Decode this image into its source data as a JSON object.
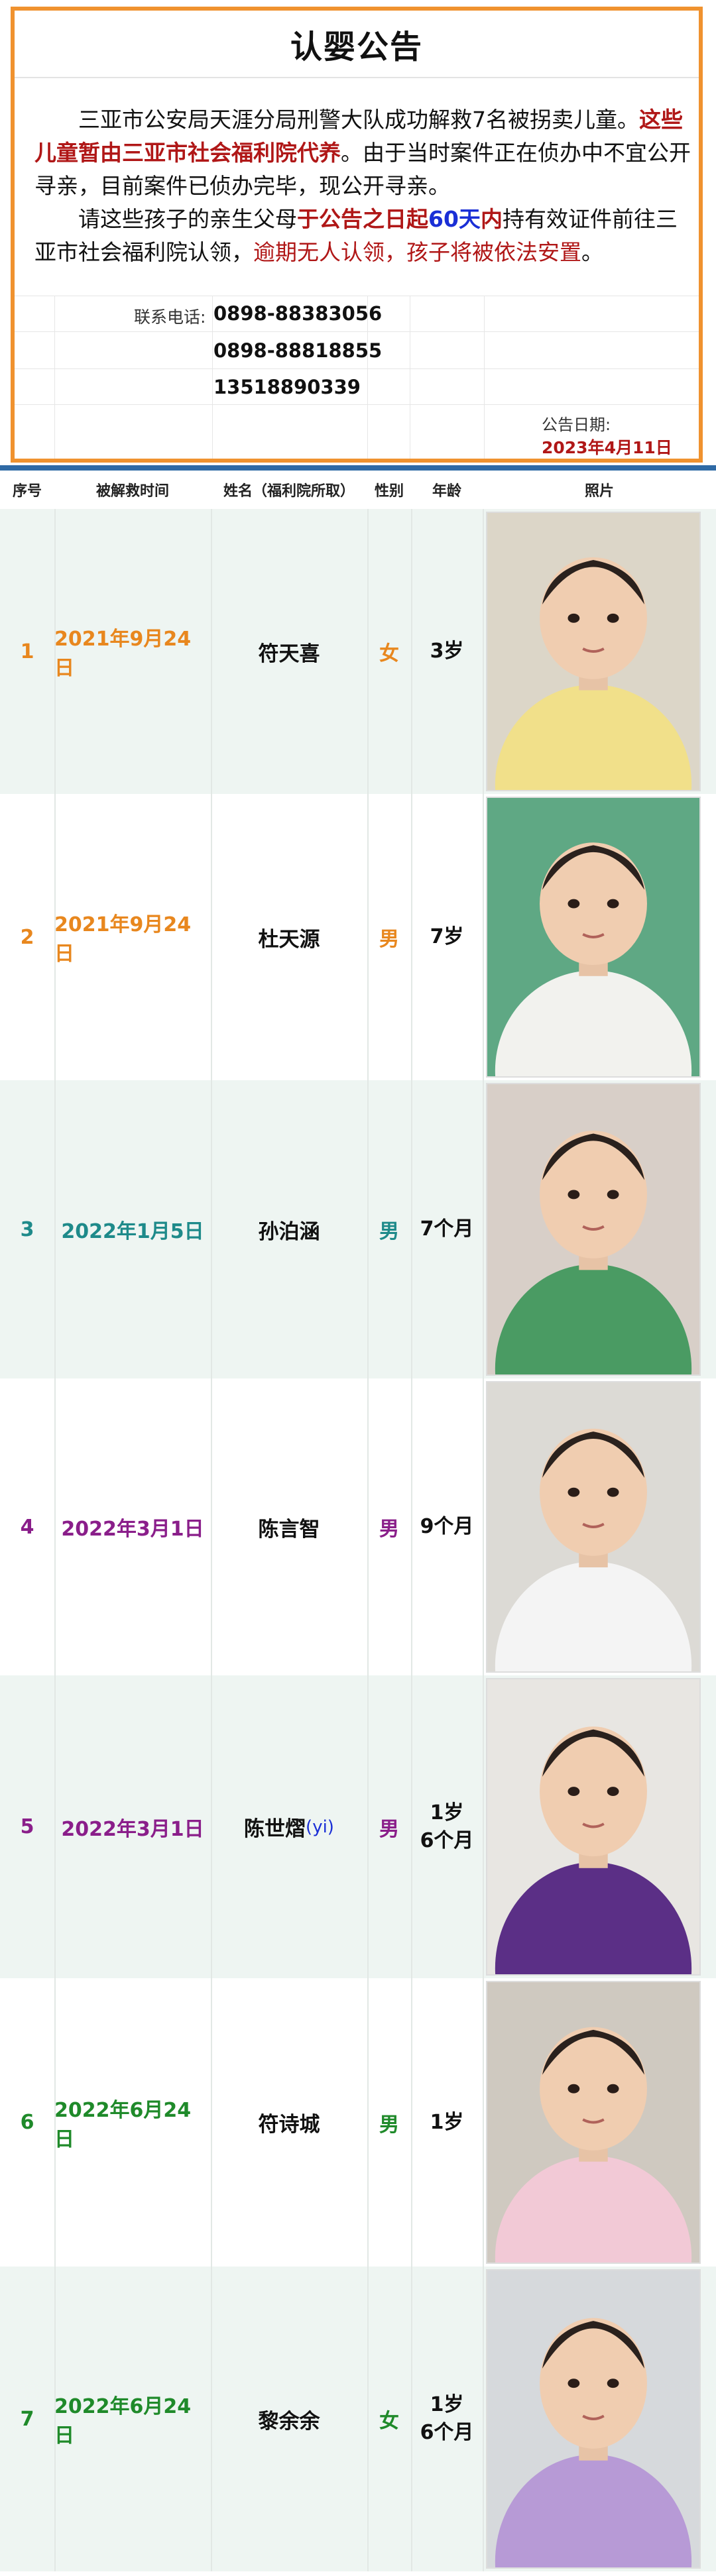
{
  "notice": {
    "title": "认婴公告",
    "para1_a": "三亚市公安局天涯分局刑警大队成功解救7名被拐卖儿童。",
    "para1_b": "这些儿童暂由三亚市社会福利院代养",
    "para1_c": "。由于当时案件正在侦办中不宜公开寻亲，目前案件已侦办完毕，现公开寻亲。",
    "para2_a": "请这些孩子的亲生父母",
    "para2_b": "于公告之日起",
    "para2_c": "60天",
    "para2_d": "内",
    "para2_e": "持有效证件前往三亚市社会福利院认领，",
    "para2_f": "逾期无人认领，孩子将被依法安置",
    "para2_g": "。",
    "contact_label": "联系电话:",
    "phones": [
      "0898-88383056",
      "0898-88818855",
      "13518890339"
    ],
    "date_label": "公告日期:",
    "date_value": "2023年4月11日"
  },
  "table": {
    "headers": [
      "序号",
      "被解救时间",
      "姓名（福利院所取）",
      "性别",
      "年龄",
      "照片"
    ],
    "rows": [
      {
        "no": "1",
        "date": "2021年9月24日",
        "name": "符天喜",
        "name_note": "",
        "gender": "女",
        "age1": "3岁",
        "age2": "",
        "color": "#e8871e",
        "shirt": "#f1e08a",
        "bg": "#dcd6c8"
      },
      {
        "no": "2",
        "date": "2021年9月24日",
        "name": "杜天源",
        "name_note": "",
        "gender": "男",
        "age1": "7岁",
        "age2": "",
        "color": "#e8871e",
        "shirt": "#f2f2ee",
        "bg": "#5fa884"
      },
      {
        "no": "3",
        "date": "2022年1月5日",
        "name": "孙泊涵",
        "name_note": "",
        "gender": "男",
        "age1": "7个月",
        "age2": "",
        "color": "#1e8a8a",
        "shirt": "#4a9b63",
        "bg": "#d8cfc8"
      },
      {
        "no": "4",
        "date": "2022年3月1日",
        "name": "陈言智",
        "name_note": "",
        "gender": "男",
        "age1": "9个月",
        "age2": "",
        "color": "#8a1e8a",
        "shirt": "#f4f4f4",
        "bg": "#dcdad5"
      },
      {
        "no": "5",
        "date": "2022年3月1日",
        "name": "陈世熠",
        "name_note": "(yi)",
        "gender": "男",
        "age1": "1岁",
        "age2": "6个月",
        "color": "#8a1e8a",
        "shirt": "#5b2f86",
        "bg": "#e8e6e2"
      },
      {
        "no": "6",
        "date": "2022年6月24日",
        "name": "符诗城",
        "name_note": "",
        "gender": "男",
        "age1": "1岁",
        "age2": "",
        "color": "#1f8a2a",
        "shirt": "#f2c9d6",
        "bg": "#cfc9c0"
      },
      {
        "no": "7",
        "date": "2022年6月24日",
        "name": "黎余余",
        "name_note": "",
        "gender": "女",
        "age1": "1岁",
        "age2": "6个月",
        "color": "#1f8a2a",
        "shirt": "#b79ad6",
        "bg": "#d6d9dc"
      }
    ]
  }
}
